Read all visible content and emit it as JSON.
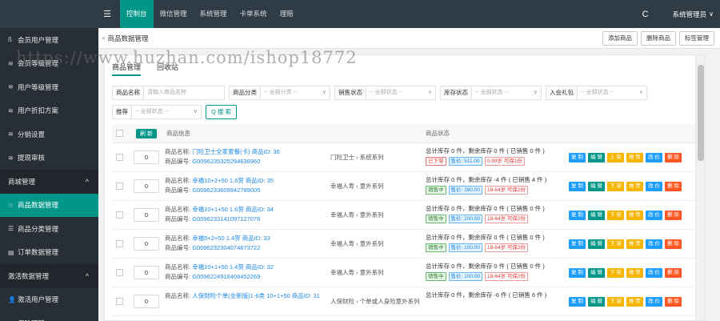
{
  "topbar": {
    "menu_icon": "hamburger-icon",
    "nav": [
      "控制台",
      "微信管理",
      "系统管理",
      "卡单系统",
      "理赔"
    ],
    "active_index": 0,
    "refresh_icon": "C",
    "user": "系统管理员",
    "caret": "∨"
  },
  "sidebar": {
    "items": [
      {
        "icon": "ß",
        "label": "会员用户管理"
      },
      {
        "icon": "≋",
        "label": "会员等级管理"
      },
      {
        "icon": "≋",
        "label": "用户等级管理"
      },
      {
        "icon": "≋",
        "label": "用户折扣方案"
      },
      {
        "icon": "≋",
        "label": "分销设置"
      },
      {
        "icon": "≋",
        "label": "提现审核"
      }
    ],
    "group1": {
      "label": "商城管理",
      "caret": "^"
    },
    "group1_items": [
      {
        "icon": "☆",
        "label": "商品数据管理",
        "active": true
      },
      {
        "icon": "☰",
        "label": "商品分类管理"
      },
      {
        "icon": "▤",
        "label": "订单数据管理"
      }
    ],
    "group2": {
      "label": "激活数据管理",
      "caret": "^"
    },
    "group2_items": [
      {
        "icon": "👤",
        "label": "激活用户管理"
      },
      {
        "icon": "⊙",
        "label": "保险理赔"
      }
    ]
  },
  "content": {
    "breadcrumb_sep": "»",
    "breadcrumb": "商品数据管理",
    "top_buttons": [
      "添加商品",
      "删除商品",
      "标签管理"
    ],
    "tabs": [
      "商品管理",
      "回收站"
    ],
    "filters": {
      "row1": [
        {
          "label": "商品名称",
          "placeholder": "请输入商品名称",
          "dropdown": false
        },
        {
          "label": "商品分类",
          "placeholder": "-- 全部分类 --",
          "dropdown": true
        },
        {
          "label": "销售状态",
          "placeholder": "-- 全部状态 --",
          "dropdown": true
        },
        {
          "label": "库存状态",
          "placeholder": "-- 全部状态 --",
          "dropdown": true
        },
        {
          "label": "入会礼包",
          "placeholder": "-- 全部状态 --",
          "dropdown": true
        }
      ],
      "row2": [
        {
          "label": "推荐",
          "placeholder": "-- 全部状态 --",
          "dropdown": true
        }
      ],
      "search_label": "搜 索",
      "search_icon": "Q"
    },
    "table": {
      "refresh_label": "刷 新",
      "col_info": "商品信息",
      "col_stock": "商品状态",
      "rows": [
        {
          "sort": "0",
          "name_label": "商品名称:",
          "name": "门险卫士全家套餐(卡) 商品ID: 36",
          "code_label": "商品编号:",
          "code": "G0096235325294636960",
          "category": "门险卫士 › 系统系列",
          "stock": "总计库存 0 件，剩余库存 0 件 ( 已销售 0 件 )",
          "badges": [
            {
              "text": "已下架",
              "style": "red"
            },
            {
              "text": "售价: 511.00",
              "style": "blue"
            },
            {
              "text": "0-99岁 可保1份",
              "style": "pink"
            }
          ],
          "first_action": "上 架"
        },
        {
          "sort": "0",
          "name_label": "商品名称:",
          "name": "幸福10+2+50 1.6贺 商品ID: 35",
          "code_label": "商品编号:",
          "code": "G0096233609942789005",
          "category": "幸福人寿 › 意外系列",
          "stock": "总计库存 0 件，剩余库存 -4 件 ( 已销售 4 件 )",
          "badges": [
            {
              "text": "销售中",
              "style": "green"
            },
            {
              "text": "售价: 280.00",
              "style": "blue"
            },
            {
              "text": "18-64岁 可保2份",
              "style": "pink"
            }
          ],
          "first_action": "下 架"
        },
        {
          "sort": "0",
          "name_label": "商品名称:",
          "name": "幸福10+1+50 1.6贺 商品ID: 34",
          "code_label": "商品编号:",
          "code": "G0096233141097127076",
          "category": "幸福人寿 › 意外系列",
          "stock": "总计库存 0 件，剩余库存 0 件 ( 已销售 0 件 )",
          "badges": [
            {
              "text": "销售中",
              "style": "green"
            },
            {
              "text": "售价: 200.00",
              "style": "blue"
            },
            {
              "text": "18-64岁 可保2份",
              "style": "pink"
            }
          ],
          "first_action": "下 架"
        },
        {
          "sort": "0",
          "name_label": "商品名称:",
          "name": "幸福5+2+50 1.4贺 商品ID: 33",
          "code_label": "商品编号:",
          "code": "G0096232304074673722",
          "category": "幸福人寿 › 意外系列",
          "stock": "总计库存 0 件，剩余库存 0 件 ( 已销售 0 件 )",
          "badges": [
            {
              "text": "销售中",
              "style": "green"
            },
            {
              "text": "售价: 100.00",
              "style": "blue"
            },
            {
              "text": "18-64岁 可保2份",
              "style": "pink"
            }
          ],
          "first_action": "下 架"
        },
        {
          "sort": "0",
          "name_label": "商品名称:",
          "name": "幸福10+1+50 1.4贺 商品ID: 32",
          "code_label": "商品编号:",
          "code": "G0096224916408452269",
          "category": "幸福人寿 › 意外系列",
          "stock": "总计库存 0 件，剩余库存 0 件 ( 已销售 0 件 )",
          "badges": [
            {
              "text": "销售中",
              "style": "green"
            },
            {
              "text": "售价: 100.00",
              "style": "blue"
            },
            {
              "text": "18-64岁 可保2份",
              "style": "pink"
            }
          ],
          "first_action": "下 架"
        },
        {
          "sort": "0",
          "name_label": "商品名称:",
          "name": "人保财险个单(全新版)1-6类 10+1+50 商品ID: 31",
          "code_label": "",
          "code": "",
          "category": "人保财险 › 个单或人身险意外系列",
          "stock": "总计库存 0 件，剩余库存 -6 件 ( 已销售 6 件 )",
          "badges": [],
          "first_action": "下 架"
        }
      ],
      "actions": [
        "复 制",
        "编 辑",
        "",
        "推 荐",
        "改 价",
        "删 除"
      ]
    }
  },
  "watermark": "https://www.huzhan.com/ishop18772",
  "colors": {
    "topbar": "#2f3b45",
    "sidebar": "#272e36",
    "accent": "#009688"
  }
}
